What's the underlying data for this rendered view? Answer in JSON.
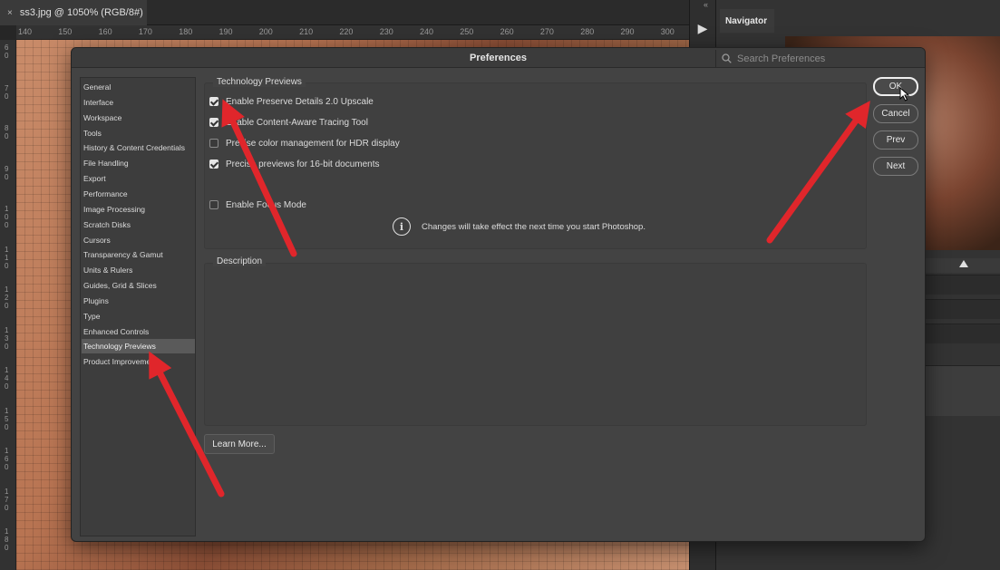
{
  "document_tab": {
    "close_glyph": "×",
    "title": "ss3.jpg @ 1050% (RGB/8#)"
  },
  "ruler": {
    "horizontal_ticks": [
      "140",
      "150",
      "160",
      "170",
      "180",
      "190",
      "200",
      "210",
      "220",
      "230",
      "240",
      "250",
      "260",
      "270",
      "280",
      "290",
      "300"
    ],
    "vertical_ticks": [
      "60",
      "70",
      "80",
      "90",
      "100",
      "110",
      "120",
      "130",
      "140",
      "150",
      "160",
      "170",
      "180"
    ]
  },
  "right_panel": {
    "play_glyph": "▶",
    "collapse_glyph": "«",
    "navigator_tab": "Navigator"
  },
  "dialog": {
    "title": "Preferences",
    "search_placeholder": "Search Preferences",
    "sidebar": {
      "items": [
        "General",
        "Interface",
        "Workspace",
        "Tools",
        "History & Content Credentials",
        "File Handling",
        "Export",
        "Performance",
        "Image Processing",
        "Scratch Disks",
        "Cursors",
        "Transparency & Gamut",
        "Units & Rulers",
        "Guides, Grid & Slices",
        "Plugins",
        "Type",
        "Enhanced Controls",
        "Technology Previews",
        "Product Improvement"
      ],
      "active_index": 17
    },
    "technology_previews": {
      "legend": "Technology Previews",
      "options": [
        {
          "label": "Enable Preserve Details 2.0 Upscale",
          "checked": true
        },
        {
          "label": "Enable Content-Aware Tracing Tool",
          "checked": true
        },
        {
          "label": "Precise color management for HDR display",
          "checked": false
        },
        {
          "label": "Precise previews for 16-bit documents",
          "checked": true
        },
        {
          "label": "Enable Focus Mode",
          "checked": false
        }
      ],
      "notice_icon": "info-icon",
      "notice": "Changes will take effect the next time you start Photoshop."
    },
    "description": {
      "legend": "Description"
    },
    "buttons": {
      "ok": "OK",
      "cancel": "Cancel",
      "prev": "Prev",
      "next": "Next",
      "learn_more": "Learn More..."
    }
  },
  "colors": {
    "annotation_arrow": "#e0262b",
    "dialog_bg": "#434343",
    "sidebar_active": "#5a5a5a"
  }
}
